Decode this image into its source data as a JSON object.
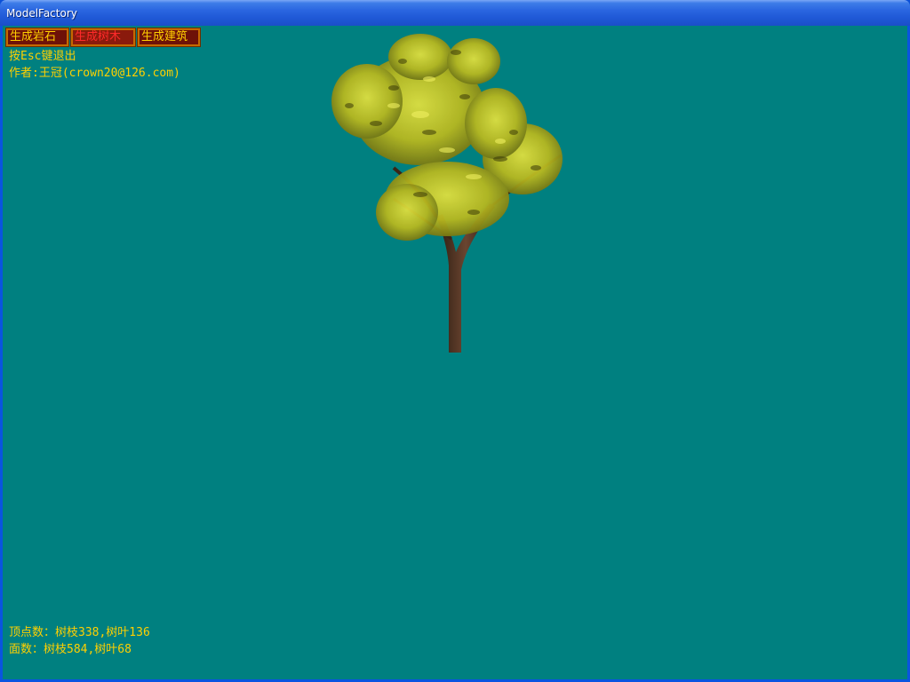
{
  "window": {
    "title": "ModelFactory"
  },
  "toolbar": {
    "generate_rock_label": "生成岩石",
    "generate_tree_label": "生成树木",
    "generate_building_label": "生成建筑"
  },
  "info": {
    "exit_hint": "按Esc键退出",
    "author": "作者:王冠(crown20@126.com)"
  },
  "stats": {
    "vertices": "顶点数：树枝338,树叶136",
    "faces": "面数：树枝584,树叶68"
  },
  "colors": {
    "viewport_background": "#008080",
    "hud_text": "#ffd000",
    "active_button_text": "#ff2a2a"
  },
  "scene": {
    "model": "tree",
    "icon": "tree-model"
  }
}
